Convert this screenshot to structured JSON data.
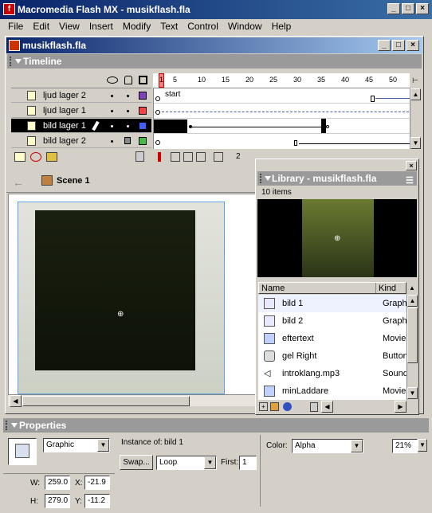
{
  "app": {
    "title": "Macromedia Flash MX - musikflash.fla"
  },
  "menu": [
    "File",
    "Edit",
    "View",
    "Insert",
    "Modify",
    "Text",
    "Control",
    "Window",
    "Help"
  ],
  "document": {
    "title": "musikflash.fla"
  },
  "timeline": {
    "header": "Timeline",
    "ruler_ticks": [
      "1",
      "5",
      "10",
      "15",
      "20",
      "25",
      "30",
      "35",
      "40",
      "45",
      "50"
    ],
    "frame_label": "start",
    "layers": [
      {
        "name": "ljud  lager  2",
        "color": "#8040c0",
        "selected": false,
        "locked": false
      },
      {
        "name": "ljud  lager  1",
        "color": "#ff4040",
        "selected": false,
        "locked": false
      },
      {
        "name": "bild lager 1",
        "color": "#4060ff",
        "selected": true,
        "locked": false
      },
      {
        "name": "bild lager 2",
        "color": "#40c040",
        "selected": false,
        "locked": true
      }
    ],
    "fps_value": "2"
  },
  "scene": {
    "name": "Scene 1"
  },
  "library": {
    "title": "Library - musikflash.fla",
    "count": "10 items",
    "col_name": "Name",
    "col_kind": "Kind",
    "items": [
      {
        "name": "bild 1",
        "kind": "Graphic",
        "icon": "graphic-icon"
      },
      {
        "name": "bild 2",
        "kind": "Graphic",
        "icon": "graphic-icon"
      },
      {
        "name": "eftertext",
        "kind": "Movie Clip",
        "icon": "movieclip-icon"
      },
      {
        "name": "gel Right",
        "kind": "Button",
        "icon": "button-icon"
      },
      {
        "name": "introklang.mp3",
        "kind": "Sound",
        "icon": "sound-icon"
      },
      {
        "name": "minLaddare",
        "kind": "Movie Clip",
        "icon": "movieclip-icon"
      }
    ]
  },
  "properties": {
    "header": "Properties",
    "symbol_type": "Graphic",
    "instance_of_label": "Instance of:",
    "instance_of": "bild 1",
    "swap_label": "Swap...",
    "loop_value": "Loop",
    "first_label": "First:",
    "first_value": "1",
    "color_label": "Color:",
    "color_value": "Alpha",
    "alpha_value": "21%",
    "w_label": "W:",
    "w_value": "259.0",
    "h_label": "H:",
    "h_value": "279.0",
    "x_label": "X:",
    "x_value": "-21.9",
    "y_label": "Y:",
    "y_value": "-11.2"
  }
}
